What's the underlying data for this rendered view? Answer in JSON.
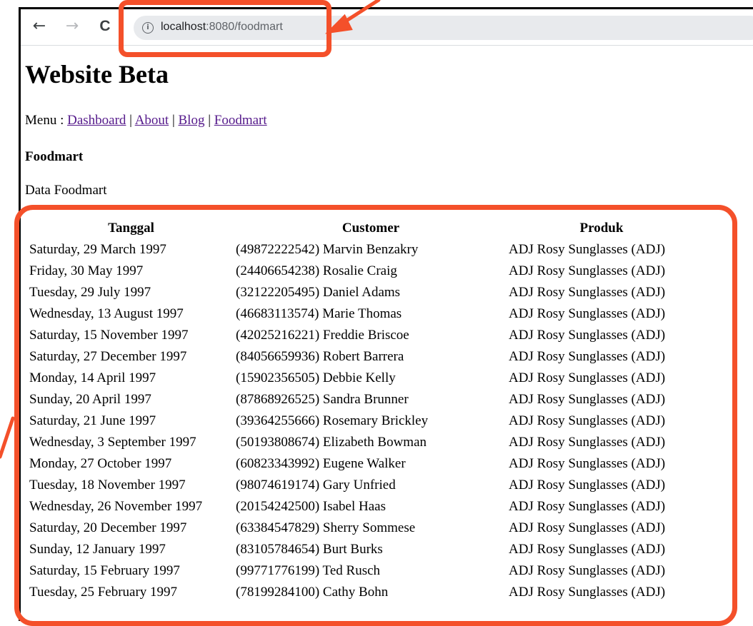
{
  "browser": {
    "back_icon": "←",
    "forward_icon": "→",
    "reload_icon": "C",
    "info_icon": "i",
    "url_host": "localhost",
    "url_path": ":8080/foodmart"
  },
  "page": {
    "title": "Website Beta",
    "menu_prefix": "Menu : ",
    "menu": [
      "Dashboard",
      "About",
      "Blog",
      "Foodmart"
    ],
    "separator": " | ",
    "section_title": "Foodmart",
    "subtitle": "Data Foodmart"
  },
  "table": {
    "headers": [
      "Tanggal",
      "Customer",
      "Produk"
    ],
    "rows": [
      [
        "Saturday, 29 March 1997",
        "(49872222542) Marvin Benzakry",
        "ADJ Rosy Sunglasses (ADJ)"
      ],
      [
        "Friday, 30 May 1997",
        "(24406654238) Rosalie Craig",
        "ADJ Rosy Sunglasses (ADJ)"
      ],
      [
        "Tuesday, 29 July 1997",
        "(32122205495) Daniel Adams",
        "ADJ Rosy Sunglasses (ADJ)"
      ],
      [
        "Wednesday, 13 August 1997",
        "(46683113574) Marie Thomas",
        "ADJ Rosy Sunglasses (ADJ)"
      ],
      [
        "Saturday, 15 November 1997",
        "(42025216221) Freddie Briscoe",
        "ADJ Rosy Sunglasses (ADJ)"
      ],
      [
        "Saturday, 27 December 1997",
        "(84056659936) Robert Barrera",
        "ADJ Rosy Sunglasses (ADJ)"
      ],
      [
        "Monday, 14 April 1997",
        "(15902356505) Debbie Kelly",
        "ADJ Rosy Sunglasses (ADJ)"
      ],
      [
        "Sunday, 20 April 1997",
        "(87868926525) Sandra Brunner",
        "ADJ Rosy Sunglasses (ADJ)"
      ],
      [
        "Saturday, 21 June 1997",
        "(39364255666) Rosemary Brickley",
        "ADJ Rosy Sunglasses (ADJ)"
      ],
      [
        "Wednesday, 3 September 1997",
        "(50193808674) Elizabeth Bowman",
        "ADJ Rosy Sunglasses (ADJ)"
      ],
      [
        "Monday, 27 October 1997",
        "(60823343992) Eugene Walker",
        "ADJ Rosy Sunglasses (ADJ)"
      ],
      [
        "Tuesday, 18 November 1997",
        "(98074619174) Gary Unfried",
        "ADJ Rosy Sunglasses (ADJ)"
      ],
      [
        "Wednesday, 26 November 1997",
        "(20154242500) Isabel Haas",
        "ADJ Rosy Sunglasses (ADJ)"
      ],
      [
        "Saturday, 20 December 1997",
        "(63384547829) Sherry Sommese",
        "ADJ Rosy Sunglasses (ADJ)"
      ],
      [
        "Sunday, 12 January 1997",
        "(83105784654) Burt Burks",
        "ADJ Rosy Sunglasses (ADJ)"
      ],
      [
        "Saturday, 15 February 1997",
        "(99771776199) Ted Rusch",
        "ADJ Rosy Sunglasses (ADJ)"
      ],
      [
        "Tuesday, 25 February 1997",
        "(78199284100) Cathy Bohn",
        "ADJ Rosy Sunglasses (ADJ)"
      ]
    ]
  },
  "colors": {
    "annotation": "#f4502a",
    "visited_link": "#551a8b"
  }
}
